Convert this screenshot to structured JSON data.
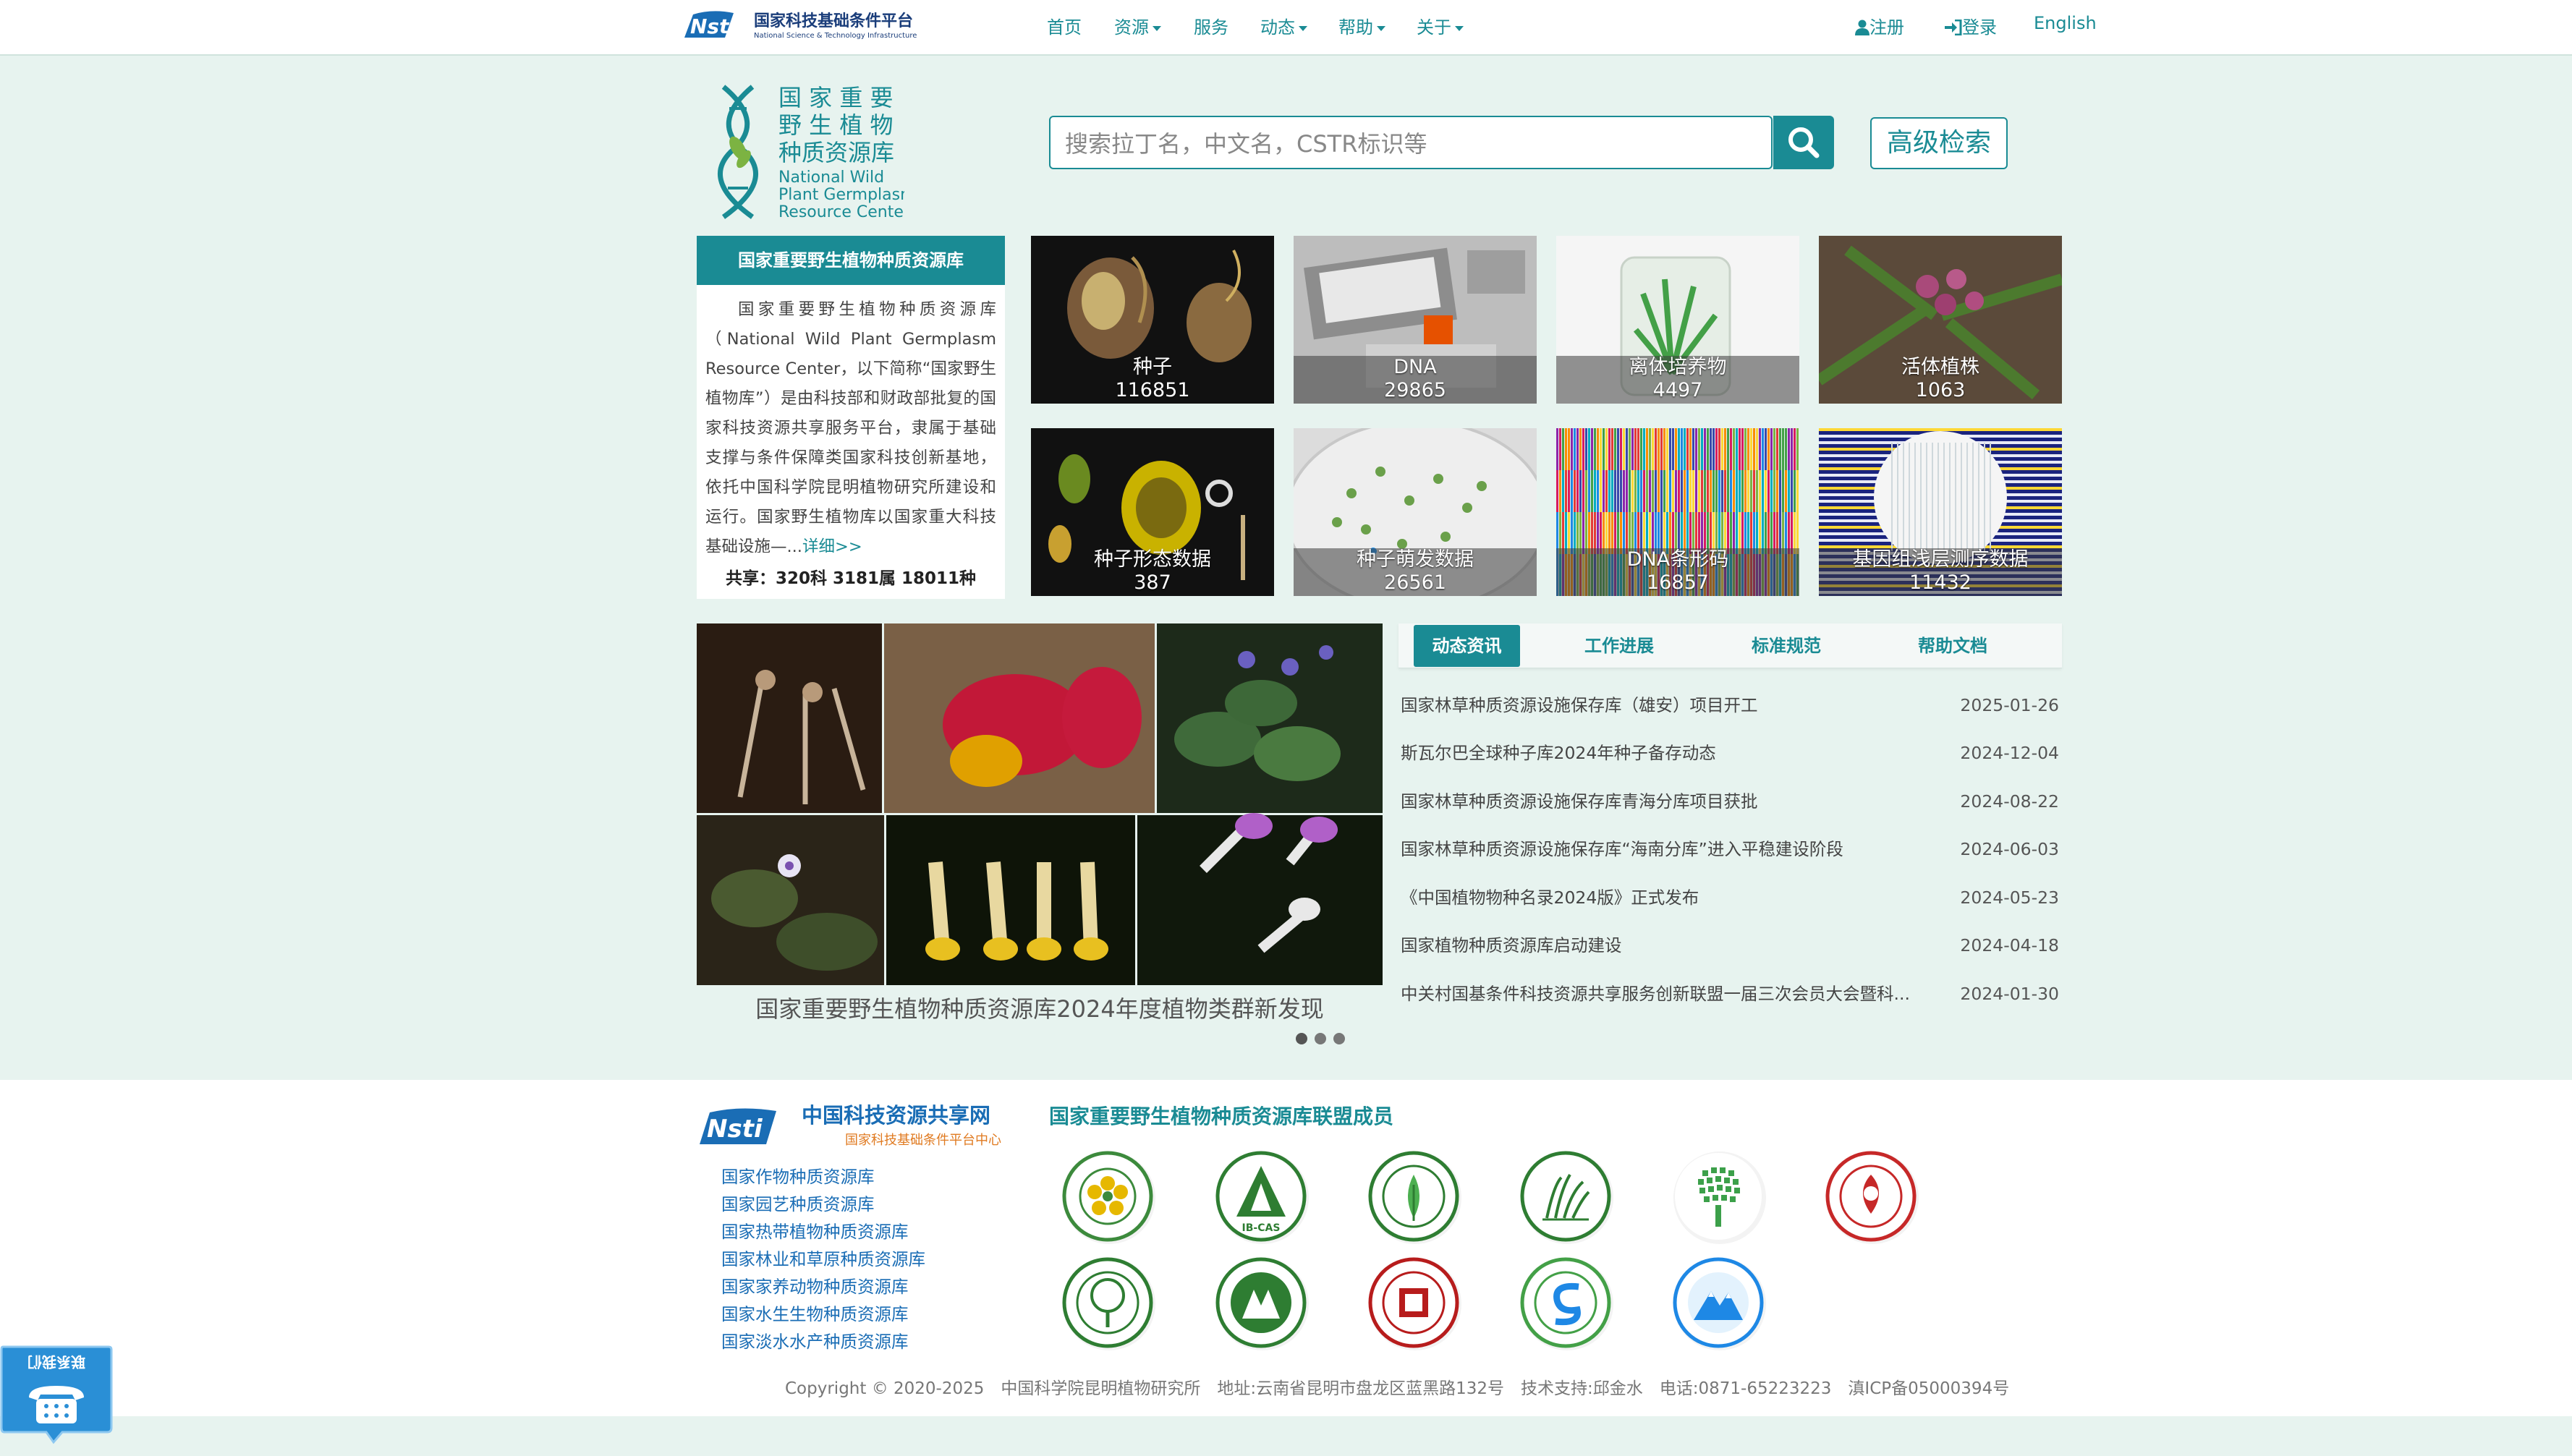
{
  "navbar": {
    "brand_cn": "国家科技基础条件平台",
    "brand_en": "National Science & Technology Infrastructure",
    "items": [
      {
        "label": "首页"
      },
      {
        "label": "资源"
      },
      {
        "label": "服务"
      },
      {
        "label": "动态"
      },
      {
        "label": "帮助"
      },
      {
        "label": "关于"
      }
    ],
    "register": "注册",
    "login": "登录",
    "language": "English"
  },
  "site": {
    "name_cn_line1": "国 家 重 要",
    "name_cn_line2": "野 生 植 物",
    "name_cn_line3": "种质资源库",
    "name_en_line1": "National Wild",
    "name_en_line2": "Plant Germplasm",
    "name_en_line3": "Resource Center"
  },
  "search": {
    "placeholder": "搜索拉丁名，中文名，CSTR标识等",
    "advanced_label": "高级检索"
  },
  "intro": {
    "title": "国家重要野生植物种质资源库",
    "text": "国家重要野生植物种质资源库（National Wild Plant Germplasm Resource Center，以下简称“国家野生植物库”）是由科技部和财政部批复的国家科技资源共享服务平台，隶属于基础支撑与条件保障类国家科技创新基地，依托中国科学院昆明植物研究所建设和运行。国家野生植物库以国家重大科技基础设施—...",
    "more_link": "详细>>",
    "stat": "共享：320科 3181属 18011种"
  },
  "tiles": [
    {
      "label": "种子",
      "count": "116851"
    },
    {
      "label": "DNA",
      "count": "29865"
    },
    {
      "label": "离体培养物",
      "count": "4497"
    },
    {
      "label": "活体植株",
      "count": "1063"
    },
    {
      "label": "种子形态数据",
      "count": "387"
    },
    {
      "label": "种子萌发数据",
      "count": "26561"
    },
    {
      "label": "DNA条形码",
      "count": "16857"
    },
    {
      "label": "基因组浅层测序数据",
      "count": "11432"
    }
  ],
  "carousel": {
    "caption": "国家重要野生植物种质资源库2024年度植物类群新发现",
    "slides": 3,
    "active": 1
  },
  "news": {
    "tabs": [
      {
        "label": "动态资讯"
      },
      {
        "label": "工作进展"
      },
      {
        "label": "标准规范"
      },
      {
        "label": "帮助文档"
      }
    ],
    "active_tab": 0,
    "items": [
      {
        "title": "国家林草种质资源设施保存库（雄安）项目开工",
        "date": "2025-01-26"
      },
      {
        "title": "斯瓦尔巴全球种子库2024年种子备存动态",
        "date": "2024-12-04"
      },
      {
        "title": "国家林草种质资源设施保存库青海分库项目获批",
        "date": "2024-08-22"
      },
      {
        "title": "国家林草种质资源设施保存库“海南分库”进入平稳建设阶段",
        "date": "2024-06-03"
      },
      {
        "title": "《中国植物物种名录2024版》正式发布",
        "date": "2024-05-23"
      },
      {
        "title": "国家植物种质资源库启动建设",
        "date": "2024-04-18"
      },
      {
        "title": "中关村国基条件科技资源共享服务创新联盟一届三次会员大会暨科...",
        "date": "2024-01-30"
      }
    ]
  },
  "footer": {
    "share_net_title": "中国科技资源共享网",
    "share_net_sub": "国家科技基础条件平台中心",
    "links": [
      {
        "label": "国家作物种质资源库"
      },
      {
        "label": "国家园艺种质资源库"
      },
      {
        "label": "国家热带植物种质资源库"
      },
      {
        "label": "国家林业和草原种质资源库"
      },
      {
        "label": "国家家养动物种质资源库"
      },
      {
        "label": "国家水生生物种质资源库"
      },
      {
        "label": "国家淡水水产种质资源库"
      }
    ],
    "members_title": "国家重要野生植物种质资源库联盟成员",
    "member_emblem_sub": "IB-CAS",
    "contact_label": "联系我们",
    "copyright": "Copyright © 2020-2025　中国科学院昆明植物研究所　地址:云南省昆明市盘龙区蓝黑路132号　技术支持:邱金水　电话:0871-65223223　滇ICP备05000394号"
  },
  "colors": {
    "accent": "#1a8b94",
    "page_bg": "#e7f3ef",
    "link_blue": "#1a6db5"
  }
}
